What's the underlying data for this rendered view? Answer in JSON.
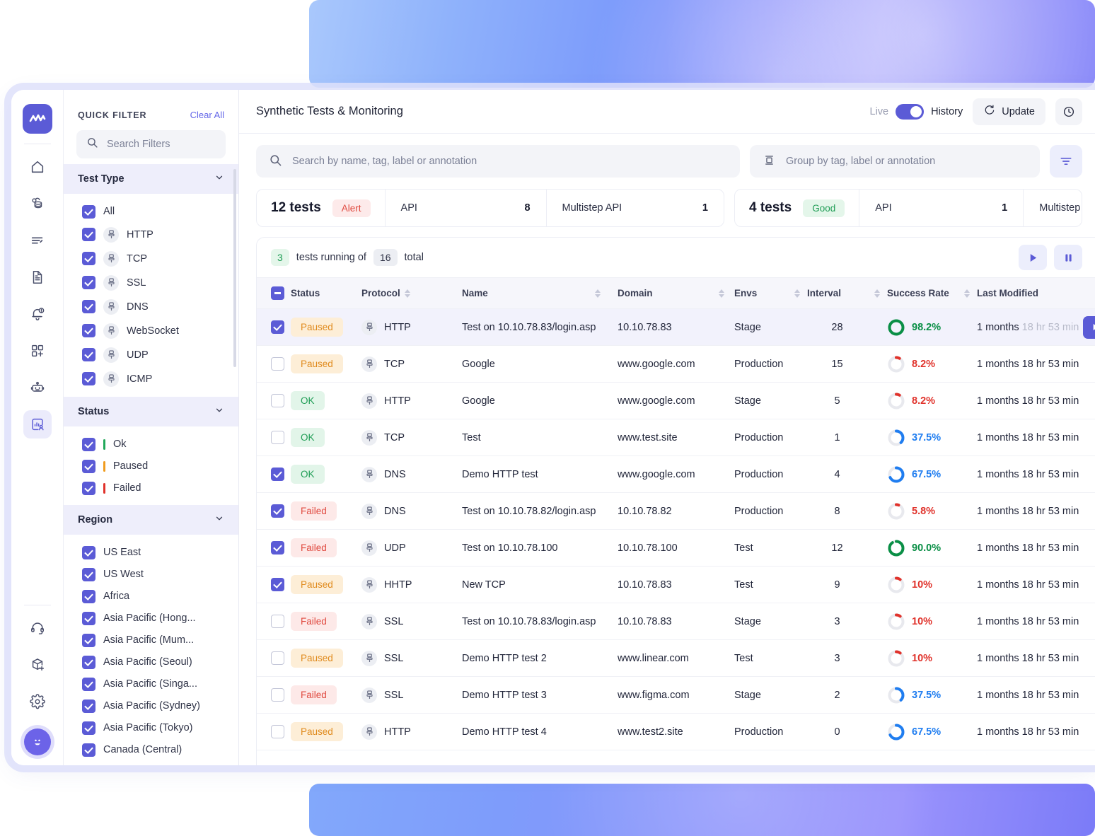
{
  "rail": {
    "logo_name": "app-logo",
    "items": [
      {
        "name": "home",
        "icon": "home-icon"
      },
      {
        "name": "infrastructure",
        "icon": "database-cloud-icon"
      },
      {
        "name": "logs",
        "icon": "filter-lines-icon"
      },
      {
        "name": "reports",
        "icon": "document-icon"
      },
      {
        "name": "alerts",
        "icon": "bell-alert-icon"
      },
      {
        "name": "integrations",
        "icon": "add-widget-icon"
      },
      {
        "name": "automation",
        "icon": "robot-icon"
      },
      {
        "name": "synthetics",
        "icon": "synthetic-monitor-icon"
      }
    ],
    "bottom_items": [
      {
        "name": "support",
        "icon": "headset-icon"
      },
      {
        "name": "packages",
        "icon": "cube-plus-icon"
      },
      {
        "name": "settings",
        "icon": "gear-icon"
      }
    ],
    "avatar_name": "user-avatar"
  },
  "sidebar": {
    "title": "QUICK FILTER",
    "clear_all": "Clear All",
    "search_placeholder": "Search Filters",
    "facets": [
      {
        "title": "Test Type",
        "options": [
          {
            "label": "All",
            "checked": true,
            "protocol": false
          },
          {
            "label": "HTTP",
            "checked": true,
            "protocol": true
          },
          {
            "label": "TCP",
            "checked": true,
            "protocol": true
          },
          {
            "label": "SSL",
            "checked": true,
            "protocol": true
          },
          {
            "label": "DNS",
            "checked": true,
            "protocol": true
          },
          {
            "label": "WebSocket",
            "checked": true,
            "protocol": true
          },
          {
            "label": "UDP",
            "checked": true,
            "protocol": true
          },
          {
            "label": "ICMP",
            "checked": true,
            "protocol": true
          }
        ]
      },
      {
        "title": "Status",
        "options": [
          {
            "label": "Ok",
            "checked": true,
            "color": "#21a85a"
          },
          {
            "label": "Paused",
            "checked": true,
            "color": "#f09c1f"
          },
          {
            "label": "Failed",
            "checked": true,
            "color": "#e0322b"
          }
        ]
      },
      {
        "title": "Region",
        "options": [
          {
            "label": "US East",
            "checked": true
          },
          {
            "label": "US West",
            "checked": true
          },
          {
            "label": "Africa",
            "checked": true
          },
          {
            "label": "Asia Pacific (Hong...",
            "checked": true
          },
          {
            "label": "Asia Pacific (Mum...",
            "checked": true
          },
          {
            "label": "Asia Pacific (Seoul)",
            "checked": true
          },
          {
            "label": "Asia Pacific (Singa...",
            "checked": true
          },
          {
            "label": "Asia Pacific (Sydney)",
            "checked": true
          },
          {
            "label": "Asia Pacific (Tokyo)",
            "checked": true
          },
          {
            "label": "Canada (Central)",
            "checked": true
          }
        ]
      }
    ]
  },
  "topbar": {
    "title": "Synthetic Tests & Monitoring",
    "toggle_left": "Live",
    "toggle_right": "History",
    "toggle_on": true,
    "update_label": "Update",
    "clock_icon": "clock-icon",
    "refresh_icon": "refresh-icon"
  },
  "search": {
    "placeholder": "Search by name, tag, label or annotation",
    "group_placeholder": "Group by tag, label or annotation",
    "search_icon": "search-icon",
    "group_icon": "group-by-icon",
    "filter_button_icon": "filter-icon"
  },
  "cards": [
    {
      "count": "12 tests",
      "badge": "Alert",
      "badge_type": "alert",
      "segments": [
        {
          "label": "API",
          "value": "8"
        },
        {
          "label": "Multistep  API",
          "value": "1"
        }
      ]
    },
    {
      "count": "4 tests",
      "badge": "Good",
      "badge_type": "good",
      "segments": [
        {
          "label": "API",
          "value": "1"
        },
        {
          "label": "Multistep",
          "value": ""
        }
      ]
    }
  ],
  "runbar": {
    "running": "3",
    "text_mid": "tests running of",
    "total": "16",
    "text_end": "total",
    "play_icon": "play-icon",
    "pause_icon": "pause-icon"
  },
  "table": {
    "columns": [
      {
        "key": "status",
        "label": "Status",
        "sortable": false
      },
      {
        "key": "protocol",
        "label": "Protocol",
        "sortable": true
      },
      {
        "key": "name",
        "label": "Name",
        "sortable": true
      },
      {
        "key": "domain",
        "label": "Domain",
        "sortable": true
      },
      {
        "key": "envs",
        "label": "Envs",
        "sortable": true
      },
      {
        "key": "interval",
        "label": "Interval",
        "sortable": true
      },
      {
        "key": "success_rate",
        "label": "Success Rate",
        "sortable": true
      },
      {
        "key": "last_modified",
        "label": "Last Modified",
        "sortable": false
      }
    ],
    "select_all_state": "indeterminate",
    "rows": [
      {
        "checked": true,
        "selected": true,
        "status": "Paused",
        "protocol": "HTTP",
        "name": "Test on 10.10.78.83/login.asp",
        "domain": "10.10.78.83",
        "envs": "Stage",
        "interval": "28",
        "success_rate": 98.2,
        "success_label": "98.2%",
        "rate_color": "#0a8f46",
        "last_modified": "1 months ",
        "last_modified_fade": "18 hr 53 min",
        "has_play": true
      },
      {
        "checked": false,
        "selected": false,
        "status": "Paused",
        "protocol": "TCP",
        "name": "Google",
        "domain": "www.google.com",
        "envs": "Production",
        "interval": "15",
        "success_rate": 8.2,
        "success_label": "8.2%",
        "rate_color": "#e0322b",
        "last_modified": "1 months 18 hr 53 min",
        "last_modified_fade": "",
        "has_play": false
      },
      {
        "checked": false,
        "selected": false,
        "status": "OK",
        "protocol": "HTTP",
        "name": "Google",
        "domain": "www.google.com",
        "envs": "Stage",
        "interval": "5",
        "success_rate": 8.2,
        "success_label": "8.2%",
        "rate_color": "#e0322b",
        "last_modified": "1 months 18 hr 53 min",
        "last_modified_fade": "",
        "has_play": false
      },
      {
        "checked": false,
        "selected": false,
        "status": "OK",
        "protocol": "TCP",
        "name": "Test",
        "domain": "www.test.site",
        "envs": "Production",
        "interval": "1",
        "success_rate": 37.5,
        "success_label": "37.5%",
        "rate_color": "#1f7df0",
        "last_modified": "1 months 18 hr 53 min",
        "last_modified_fade": "",
        "has_play": false
      },
      {
        "checked": true,
        "selected": false,
        "status": "OK",
        "protocol": "DNS",
        "name": "Demo HTTP test",
        "domain": "www.google.com",
        "envs": "Production",
        "interval": "4",
        "success_rate": 67.5,
        "success_label": "67.5%",
        "rate_color": "#1f7df0",
        "last_modified": "1 months 18 hr 53 min",
        "last_modified_fade": "",
        "has_play": false
      },
      {
        "checked": true,
        "selected": false,
        "status": "Failed",
        "protocol": "DNS",
        "name": "Test on 10.10.78.82/login.asp",
        "domain": "10.10.78.82",
        "envs": "Production",
        "interval": "8",
        "success_rate": 5.8,
        "success_label": "5.8%",
        "rate_color": "#e0322b",
        "last_modified": "1 months 18 hr 53 min",
        "last_modified_fade": "",
        "has_play": false
      },
      {
        "checked": true,
        "selected": false,
        "status": "Failed",
        "protocol": "UDP",
        "name": "Test on 10.10.78.100",
        "domain": "10.10.78.100",
        "envs": "Test",
        "interval": "12",
        "success_rate": 90.0,
        "success_label": "90.0%",
        "rate_color": "#0a8f46",
        "last_modified": "1 months 18 hr 53 min",
        "last_modified_fade": "",
        "has_play": false
      },
      {
        "checked": true,
        "selected": false,
        "status": "Paused",
        "protocol": "HHTP",
        "name": "New TCP",
        "domain": "10.10.78.83",
        "envs": "Test",
        "interval": "9",
        "success_rate": 10,
        "success_label": "10%",
        "rate_color": "#e0322b",
        "last_modified": "1 months 18 hr 53 min",
        "last_modified_fade": "",
        "has_play": false
      },
      {
        "checked": false,
        "selected": false,
        "status": "Failed",
        "protocol": "SSL",
        "name": "Test on 10.10.78.83/login.asp",
        "domain": "10.10.78.83",
        "envs": "Stage",
        "interval": "3",
        "success_rate": 10,
        "success_label": "10%",
        "rate_color": "#e0322b",
        "last_modified": "1 months 18 hr 53 min",
        "last_modified_fade": "",
        "has_play": false
      },
      {
        "checked": false,
        "selected": false,
        "status": "Paused",
        "protocol": "SSL",
        "name": "Demo HTTP test 2",
        "domain": "www.linear.com",
        "envs": "Test",
        "interval": "3",
        "success_rate": 10,
        "success_label": "10%",
        "rate_color": "#e0322b",
        "last_modified": "1 months 18 hr 53 min",
        "last_modified_fade": "",
        "has_play": false
      },
      {
        "checked": false,
        "selected": false,
        "status": "Failed",
        "protocol": "SSL",
        "name": "Demo HTTP test 3",
        "domain": "www.figma.com",
        "envs": "Stage",
        "interval": "2",
        "success_rate": 37.5,
        "success_label": "37.5%",
        "rate_color": "#1f7df0",
        "last_modified": "1 months 18 hr 53 min",
        "last_modified_fade": "",
        "has_play": false
      },
      {
        "checked": false,
        "selected": false,
        "status": "Paused",
        "protocol": "HTTP",
        "name": "Demo HTTP test 4",
        "domain": "www.test2.site",
        "envs": "Production",
        "interval": "0",
        "success_rate": 67.5,
        "success_label": "67.5%",
        "rate_color": "#1f7df0",
        "last_modified": "1 months 18 hr 53 min",
        "last_modified_fade": "",
        "has_play": false
      }
    ]
  },
  "colors": {
    "accent": "#5b5bd6",
    "ok": "#1f9d55",
    "paused": "#e08b1e",
    "failed": "#e0493f",
    "blue": "#1f7df0",
    "green_dark": "#0a8f46"
  }
}
